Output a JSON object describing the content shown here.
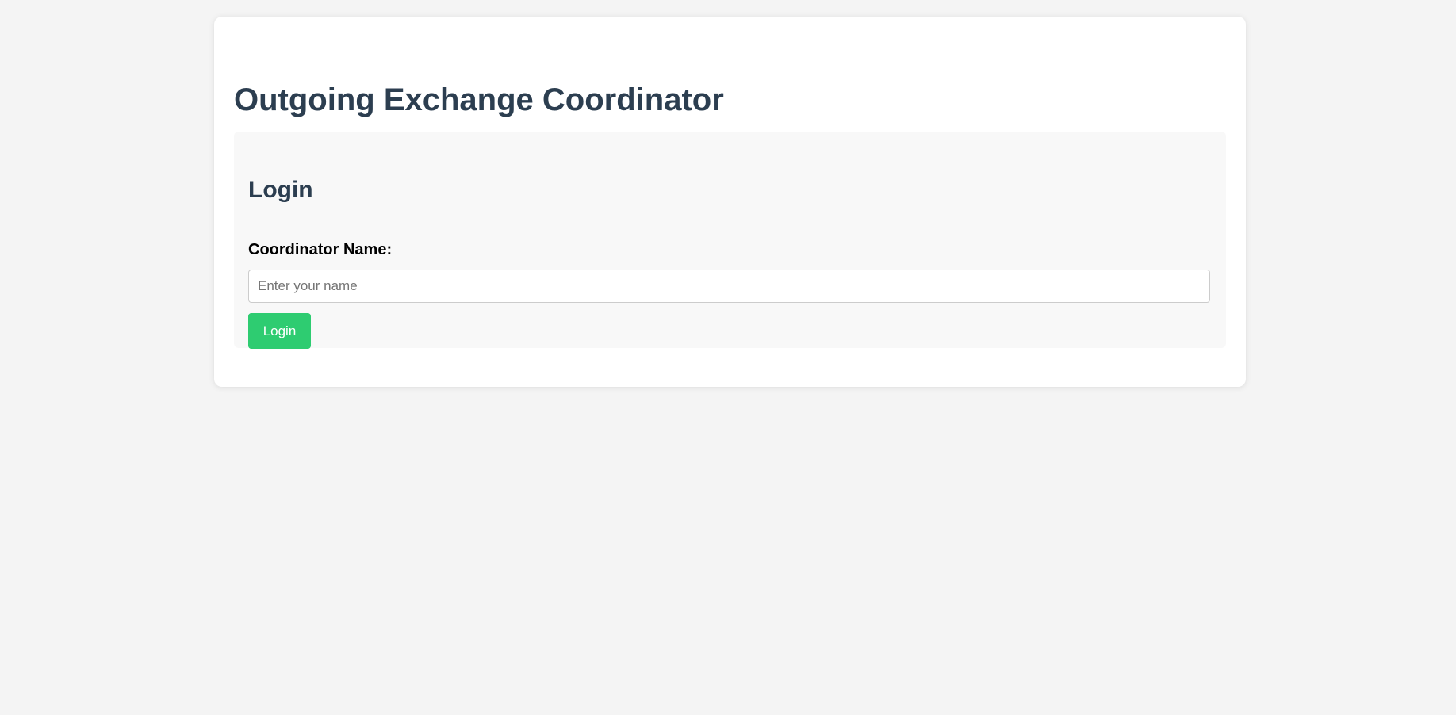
{
  "header": {
    "title": "Outgoing Exchange Coordinator"
  },
  "login": {
    "heading": "Login",
    "name_label": "Coordinator Name:",
    "name_value": "",
    "name_placeholder": "Enter your name",
    "submit_label": "Login"
  },
  "colors": {
    "page_background": "#f4f4f4",
    "card_background": "#ffffff",
    "section_background": "#f8f8f8",
    "heading_text": "#2c3e50",
    "button_accent": "#2ecc71"
  }
}
